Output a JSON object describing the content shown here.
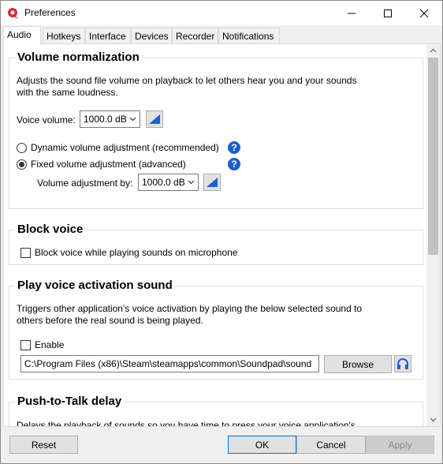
{
  "window": {
    "title": "Preferences"
  },
  "tabs": [
    {
      "label": "Audio",
      "active": true
    },
    {
      "label": "Hotkeys"
    },
    {
      "label": "Interface"
    },
    {
      "label": "Devices"
    },
    {
      "label": "Recorder"
    },
    {
      "label": "Notifications"
    }
  ],
  "volume_normalization": {
    "title": "Volume normalization",
    "description": "Adjusts the sound file volume on playback to let others hear you and your sounds with the same loudness.",
    "voice_volume_label": "Voice volume:",
    "voice_volume_value": "1000.0 dB",
    "dynamic_label": "Dynamic volume adjustment (recommended)",
    "fixed_label": "Fixed volume adjustment (advanced)",
    "selected": "fixed",
    "adjust_by_label": "Volume adjustment by:",
    "adjust_by_value": "1000.0 dB"
  },
  "block_voice": {
    "title": "Block voice",
    "checkbox_label": "Block voice while playing sounds on microphone",
    "checked": false
  },
  "voice_activation": {
    "title": "Play voice activation sound",
    "description": "Triggers other application's voice activation by playing the below selected sound to others before the real sound is being played.",
    "enable_label": "Enable",
    "enabled": false,
    "path_value": "C:\\Program Files (x86)\\Steam\\steamapps\\common\\Soundpad\\sound",
    "browse_label": "Browse"
  },
  "push_to_talk": {
    "title": "Push-to-Talk delay",
    "description": "Delays the playback of sounds so you have time to press your voice application's"
  },
  "footer": {
    "reset_label": "Reset",
    "ok_label": "OK",
    "cancel_label": "Cancel",
    "apply_label": "Apply"
  },
  "colors": {
    "accent_blue": "#1c5fd2",
    "app_icon_red": "#d32f2f"
  }
}
